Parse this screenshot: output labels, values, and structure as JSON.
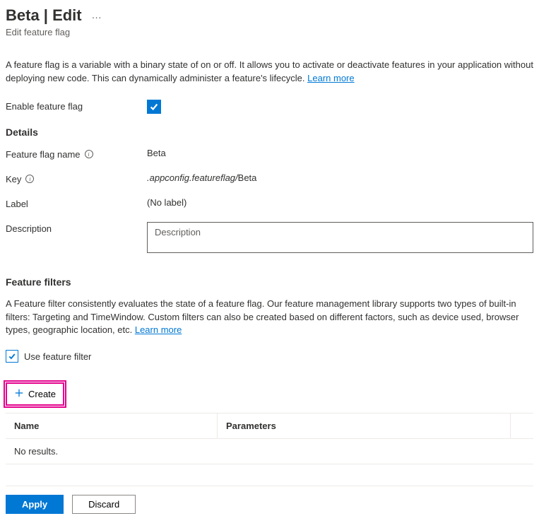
{
  "header": {
    "title": "Beta | Edit",
    "subtitle": "Edit feature flag"
  },
  "intro": {
    "text": "A feature flag is a variable with a binary state of on or off. It allows you to activate or deactivate features in your application without deploying new code. This can dynamically administer a feature's lifecycle. ",
    "learn_more": "Learn more"
  },
  "form": {
    "enable_label": "Enable feature flag",
    "enable_checked": true,
    "details_heading": "Details",
    "name_label": "Feature flag name",
    "name_value": "Beta",
    "key_label": "Key",
    "key_prefix": ".appconfig.featureflag/",
    "key_value": "Beta",
    "label_label": "Label",
    "label_value": "(No label)",
    "description_label": "Description",
    "description_placeholder": "Description",
    "description_value": ""
  },
  "filters": {
    "heading": "Feature filters",
    "intro_text": "A Feature filter consistently evaluates the state of a feature flag. Our feature management library supports two types of built-in filters: Targeting and TimeWindow. Custom filters can also be created based on different factors, such as device used, browser types, geographic location, etc. ",
    "learn_more": "Learn more",
    "use_filter_label": "Use feature filter",
    "use_filter_checked": true,
    "create_label": "Create",
    "table": {
      "col_name": "Name",
      "col_params": "Parameters",
      "empty": "No results."
    }
  },
  "footer": {
    "apply": "Apply",
    "discard": "Discard"
  }
}
